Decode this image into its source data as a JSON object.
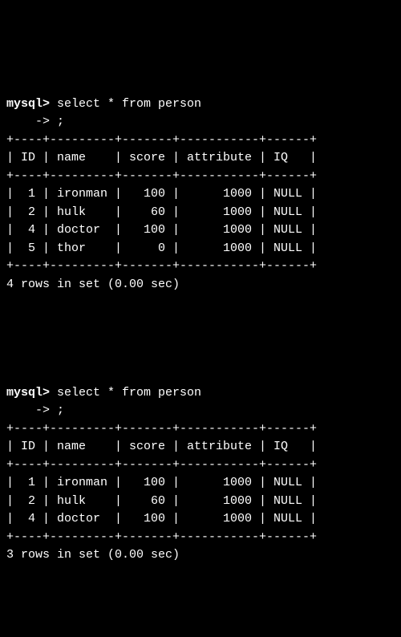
{
  "queries": [
    {
      "prompt_prefix": "mysql> ",
      "query_line1": "select * from person",
      "cont_prefix": "    -> ",
      "query_line2": ";",
      "separator": "+----+---------+-------+-----------+------+",
      "header": "| ID | name    | score | attribute | IQ   |",
      "rows": [
        "|  1 | ironman |   100 |      1000 | NULL |",
        "|  2 | hulk    |    60 |      1000 | NULL |",
        "|  4 | doctor  |   100 |      1000 | NULL |",
        "|  5 | thor    |     0 |      1000 | NULL |"
      ],
      "status": "4 rows in set (0.00 sec)",
      "table_data": {
        "columns": [
          "ID",
          "name",
          "score",
          "attribute",
          "IQ"
        ],
        "records": [
          {
            "ID": 1,
            "name": "ironman",
            "score": 100,
            "attribute": 1000,
            "IQ": "NULL"
          },
          {
            "ID": 2,
            "name": "hulk",
            "score": 60,
            "attribute": 1000,
            "IQ": "NULL"
          },
          {
            "ID": 4,
            "name": "doctor",
            "score": 100,
            "attribute": 1000,
            "IQ": "NULL"
          },
          {
            "ID": 5,
            "name": "thor",
            "score": 0,
            "attribute": 1000,
            "IQ": "NULL"
          }
        ]
      }
    },
    {
      "prompt_prefix": "mysql> ",
      "query_line1": "select * from person",
      "cont_prefix": "    -> ",
      "query_line2": ";",
      "separator": "+----+---------+-------+-----------+------+",
      "header": "| ID | name    | score | attribute | IQ   |",
      "rows": [
        "|  1 | ironman |   100 |      1000 | NULL |",
        "|  2 | hulk    |    60 |      1000 | NULL |",
        "|  4 | doctor  |   100 |      1000 | NULL |"
      ],
      "status": "3 rows in set (0.00 sec)",
      "table_data": {
        "columns": [
          "ID",
          "name",
          "score",
          "attribute",
          "IQ"
        ],
        "records": [
          {
            "ID": 1,
            "name": "ironman",
            "score": 100,
            "attribute": 1000,
            "IQ": "NULL"
          },
          {
            "ID": 2,
            "name": "hulk",
            "score": 60,
            "attribute": 1000,
            "IQ": "NULL"
          },
          {
            "ID": 4,
            "name": "doctor",
            "score": 100,
            "attribute": 1000,
            "IQ": "NULL"
          }
        ]
      }
    }
  ]
}
